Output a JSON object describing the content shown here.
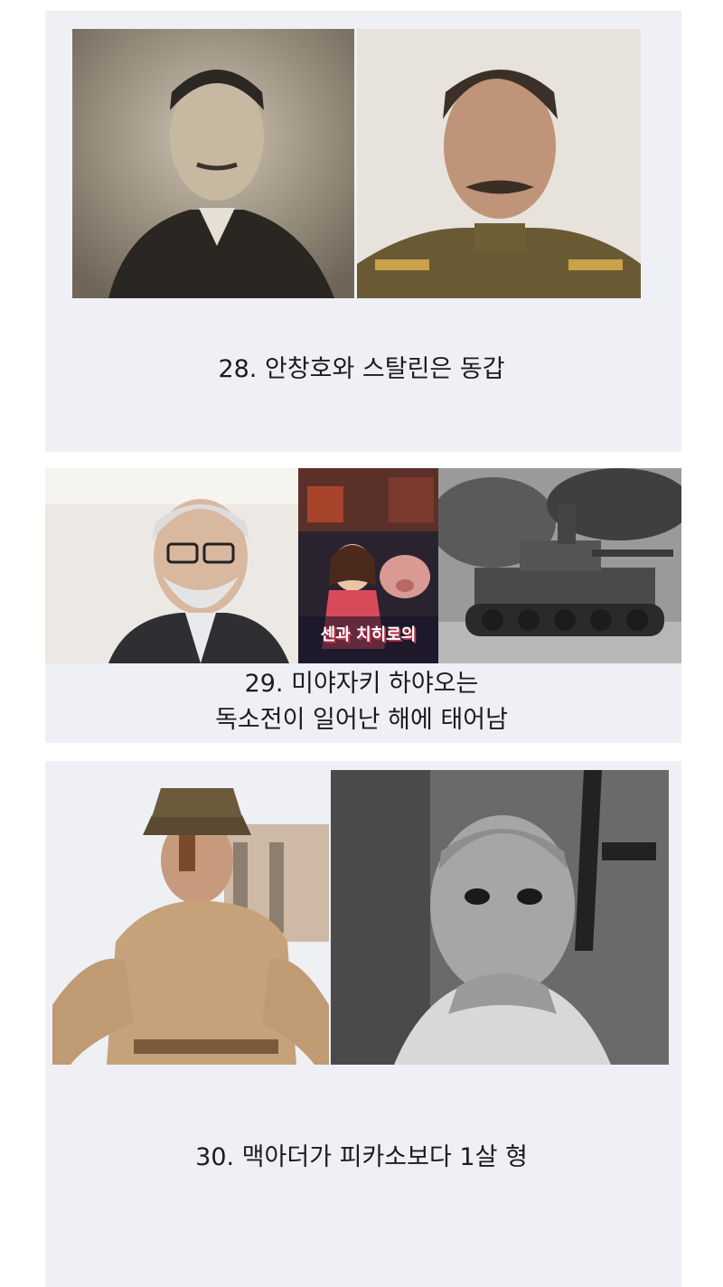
{
  "items": [
    {
      "caption": "28. 안창호와 스탈린은 동갑",
      "photos": [
        {
          "name": "ahn-changho-photo",
          "alt": "안창호"
        },
        {
          "name": "stalin-photo",
          "alt": "스탈린"
        }
      ]
    },
    {
      "caption_line1": "29. 미야자키 하야오는",
      "caption_line2": "독소전이 일어난 해에 태어남",
      "photos": [
        {
          "name": "miyazaki-photo",
          "alt": "미야자키 하야오"
        },
        {
          "name": "spirited-away-poster",
          "alt": "센과 치히로의",
          "poster_title": "센과 치히로의"
        },
        {
          "name": "eastern-front-tank-photo",
          "alt": "독소전"
        }
      ]
    },
    {
      "caption": "30. 맥아더가 피카소보다 1살 형",
      "photos": [
        {
          "name": "macarthur-photo",
          "alt": "맥아더"
        },
        {
          "name": "picasso-photo",
          "alt": "피카소"
        }
      ]
    }
  ],
  "colors": {
    "panel": "#eef0f6",
    "text": "#1c1c1c"
  }
}
